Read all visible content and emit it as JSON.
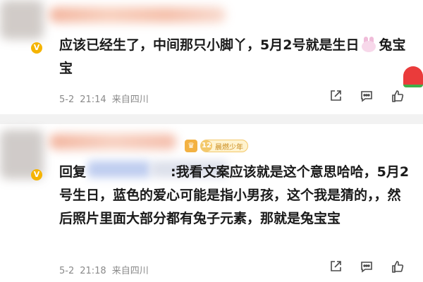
{
  "comments": [
    {
      "vip_badge": "V",
      "text": "应该已经生了，中间那只小脚丫，5月2号就是生日",
      "text_after_emoji": "兔宝宝",
      "meta": {
        "date": "5-2",
        "time": "21:14",
        "source": "来自四川"
      }
    },
    {
      "vip_badge": "V",
      "fan_badge": {
        "level": "12",
        "name": "晨燃少年"
      },
      "reply_prefix": "回复",
      "text": ":我看文案应该就是这个意思哈哈，5月2号生日，蓝色的爱心可能是指小男孩，这个我是猜的，，然后照片里面大部分都有兔子元素，那就是兔宝宝",
      "meta": {
        "date": "5-2",
        "time": "21:18",
        "source": "来自四川"
      }
    }
  ],
  "icons": {
    "share": "share-icon",
    "comment": "comment-icon",
    "like": "like-icon",
    "rabbit": "rabbit-emoji-icon",
    "melon": "watermelon-emoji-icon"
  },
  "colors": {
    "vip": "#f5b400",
    "fan_badge_text": "#c98a1a",
    "meta_text": "#8a8a8a",
    "separator": "#f2f2f2"
  }
}
